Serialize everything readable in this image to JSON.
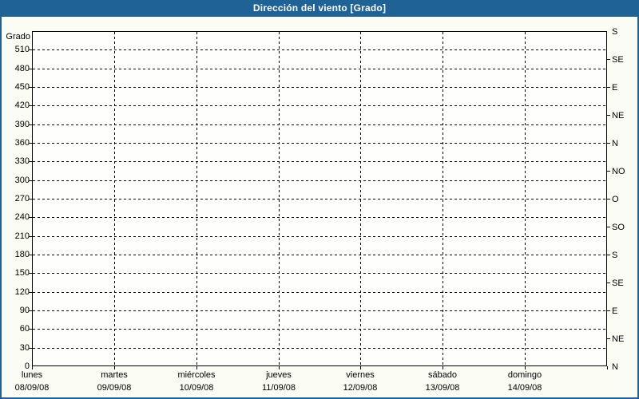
{
  "window": {
    "title": "Dirección del viento [Grado]"
  },
  "colors": {
    "title_bar": "#1F6296",
    "title_text": "#FFFFFF",
    "border": "#26608F",
    "background": "#FBFCF4",
    "grid": "#000000"
  },
  "chart_data": {
    "type": "line",
    "title": "Dirección del viento [Grado]",
    "series": [],
    "grid": true,
    "legend": "none",
    "y_axis": {
      "label": "Grado",
      "min": 0,
      "max": 540,
      "tick_step": 30,
      "ticks": [
        "0",
        "30",
        "60",
        "90",
        "120",
        "150",
        "180",
        "210",
        "240",
        "270",
        "300",
        "330",
        "360",
        "390",
        "420",
        "450",
        "480",
        "510"
      ]
    },
    "right_axis": {
      "unit": "compass-direction",
      "tick_step_degrees": 45,
      "labels": [
        {
          "deg": 540,
          "label": "S"
        },
        {
          "deg": 495,
          "label": "SE"
        },
        {
          "deg": 450,
          "label": "E"
        },
        {
          "deg": 405,
          "label": "NE"
        },
        {
          "deg": 360,
          "label": "N"
        },
        {
          "deg": 315,
          "label": "NO"
        },
        {
          "deg": 270,
          "label": "O"
        },
        {
          "deg": 225,
          "label": "SO"
        },
        {
          "deg": 180,
          "label": "S"
        },
        {
          "deg": 135,
          "label": "SE"
        },
        {
          "deg": 90,
          "label": "E"
        },
        {
          "deg": 45,
          "label": "NE"
        },
        {
          "deg": 0,
          "label": "N"
        }
      ]
    },
    "x_axis": {
      "days": [
        {
          "weekday": "lunes",
          "date": "08/09/08"
        },
        {
          "weekday": "martes",
          "date": "09/09/08"
        },
        {
          "weekday": "miércoles",
          "date": "10/09/08"
        },
        {
          "weekday": "jueves",
          "date": "11/09/08"
        },
        {
          "weekday": "viernes",
          "date": "12/09/08"
        },
        {
          "weekday": "sábado",
          "date": "13/09/08"
        },
        {
          "weekday": "domingo",
          "date": "14/09/08"
        }
      ]
    }
  }
}
